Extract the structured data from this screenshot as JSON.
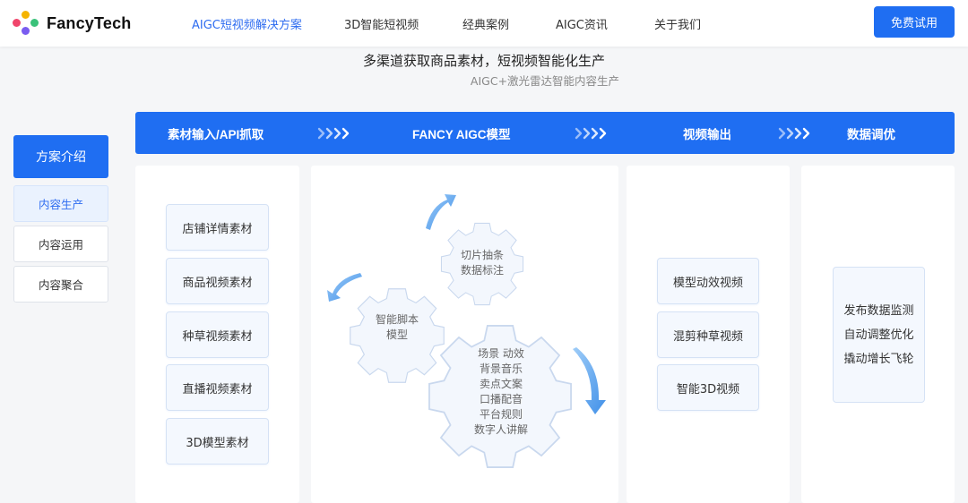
{
  "header": {
    "brand": "FancyTech",
    "nav": [
      {
        "label": "AIGC短视频解决方案",
        "active": true
      },
      {
        "label": "3D智能短视频",
        "active": false
      },
      {
        "label": "经典案例",
        "active": false
      },
      {
        "label": "AIGC资讯",
        "active": false
      },
      {
        "label": "关于我们",
        "active": false
      }
    ],
    "cta_label": "免费试用"
  },
  "hero": {
    "title": "多渠道获取商品素材，短视频智能化生产",
    "subtitle": "AIGC+激光雷达智能内容生产"
  },
  "sidebar": {
    "main_label": "方案介绍",
    "tabs": [
      {
        "label": "内容生产",
        "active": true
      },
      {
        "label": "内容运用",
        "active": false
      },
      {
        "label": "内容聚合",
        "active": false
      }
    ]
  },
  "flow": {
    "steps": [
      "素材输入/API抓取",
      "FANCY AIGC模型",
      "视频输出",
      "数据调优"
    ]
  },
  "inputs": [
    "店铺详情素材",
    "商品视频素材",
    "种草视频素材",
    "直播视频素材",
    "3D模型素材"
  ],
  "model": {
    "gear_top": [
      "切片抽条",
      "数据标注"
    ],
    "gear_left": [
      "智能脚本",
      "模型"
    ],
    "gear_bottom": [
      "场景 动效",
      "背景音乐",
      "卖点文案",
      "口播配音",
      "平台规则",
      "数字人讲解"
    ]
  },
  "outputs": [
    "模型动效视频",
    "混剪种草视频",
    "智能3D视频"
  ],
  "tuning": [
    "发布数据监测",
    "自动调整优化",
    "撬动增长飞轮"
  ],
  "colors": {
    "accent": "#1f6ef2",
    "active_text": "#2e6cf0",
    "arrow": "#5aa6f0"
  }
}
